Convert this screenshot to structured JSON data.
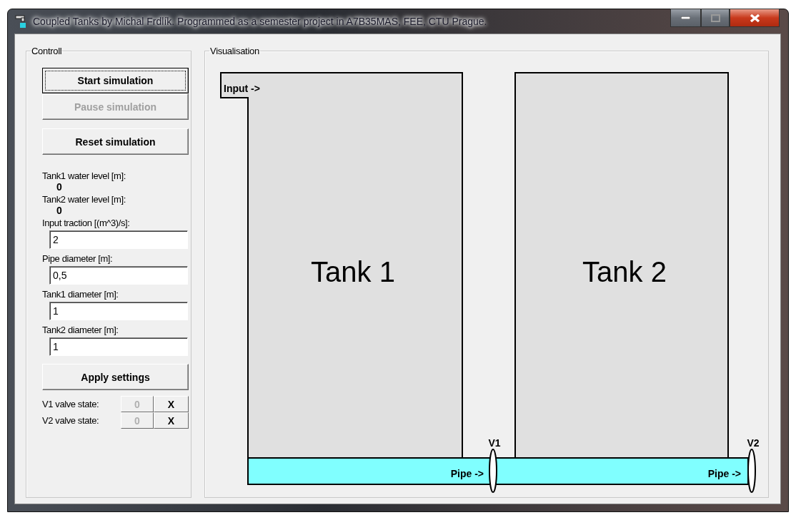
{
  "window": {
    "title": "Coupled Tanks by Michal Frdlík. Programmed as a semester project in A7B35MAS, FEE, CTU Prague."
  },
  "control": {
    "title": "Controll",
    "buttons": [
      {
        "label": "Start simulation",
        "disabled": false,
        "focused": true
      },
      {
        "label": "Pause simulation",
        "disabled": true,
        "focused": false
      },
      {
        "label": "Reset simulation",
        "disabled": false,
        "focused": false
      }
    ],
    "readouts": [
      {
        "label": "Tank1 water level [m]:",
        "value": "0"
      },
      {
        "label": "Tank2 water level [m]:",
        "value": "0"
      }
    ],
    "settings": [
      {
        "label": "Input traction [(m^3)/s]:",
        "value": "2"
      },
      {
        "label": "Pipe diameter [m]:",
        "value": "0,5"
      },
      {
        "label": "Tank1 diameter [m]:",
        "value": "1"
      },
      {
        "label": "Tank2 diameter [m]:",
        "value": "1"
      }
    ],
    "apply_button": "Apply settings",
    "valves": [
      {
        "label": "V1 valve state:",
        "open_label": "0",
        "open_disabled": true,
        "close_label": "X",
        "close_disabled": false
      },
      {
        "label": "V2 valve state:",
        "open_label": "0",
        "open_disabled": true,
        "close_label": "X",
        "close_disabled": false
      }
    ]
  },
  "visualisation": {
    "title": "Visualisation",
    "input_label": "Input ->",
    "tanks": [
      "Tank 1",
      "Tank 2"
    ],
    "pipe_labels": [
      "Pipe ->",
      "Pipe ->"
    ],
    "valves": [
      "V1",
      "V2"
    ]
  }
}
